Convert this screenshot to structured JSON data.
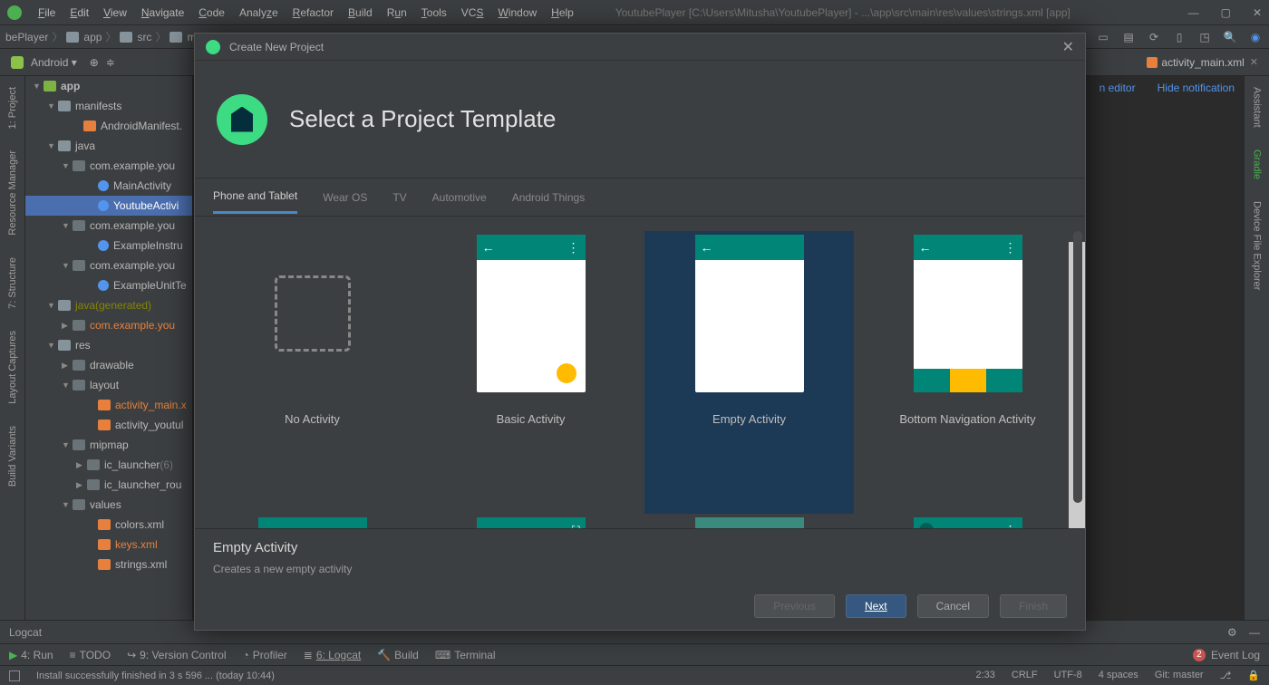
{
  "menubar": {
    "items": [
      "File",
      "Edit",
      "View",
      "Navigate",
      "Code",
      "Analyze",
      "Refactor",
      "Build",
      "Run",
      "Tools",
      "VCS",
      "Window",
      "Help"
    ],
    "title": "YoutubePlayer [C:\\Users\\Mitusha\\YoutubePlayer] - ...\\app\\src\\main\\res\\values\\strings.xml [app]"
  },
  "breadcrumbs": [
    "bePlayer",
    "app",
    "src",
    "ma"
  ],
  "toolbar": {
    "configLabel": "Android"
  },
  "openTab": {
    "name": "activity_main.xml"
  },
  "notif": {
    "editor": "n editor",
    "hide": "Hide notification"
  },
  "leftPanels": [
    "1: Project",
    "Resource Manager",
    "7: Structure",
    "Layout Captures",
    "Build Variants"
  ],
  "rightPanels": [
    "Assistant",
    "Gradle",
    "Device File Explorer"
  ],
  "tree": [
    {
      "ind": 8,
      "arrow": "▼",
      "icon": "f-mod",
      "label": "app",
      "bold": true
    },
    {
      "ind": 24,
      "arrow": "▼",
      "icon": "f-fold",
      "label": "manifests"
    },
    {
      "ind": 52,
      "arrow": "",
      "icon": "f-xml",
      "label": "AndroidManifest."
    },
    {
      "ind": 24,
      "arrow": "▼",
      "icon": "f-fold",
      "label": "java"
    },
    {
      "ind": 40,
      "arrow": "▼",
      "icon": "f-pkg",
      "label": "com.example.you"
    },
    {
      "ind": 68,
      "arrow": "",
      "icon": "f-java",
      "label": "MainActivity"
    },
    {
      "ind": 68,
      "arrow": "",
      "icon": "f-java",
      "label": "YoutubeActivi",
      "sel": true
    },
    {
      "ind": 40,
      "arrow": "▼",
      "icon": "f-pkg",
      "label": "com.example.you"
    },
    {
      "ind": 68,
      "arrow": "",
      "icon": "f-java",
      "label": "ExampleInstru"
    },
    {
      "ind": 40,
      "arrow": "▼",
      "icon": "f-pkg",
      "label": "com.example.you"
    },
    {
      "ind": 68,
      "arrow": "",
      "icon": "f-java",
      "label": "ExampleUnitTe"
    },
    {
      "ind": 24,
      "arrow": "▼",
      "icon": "f-fold",
      "label": "java",
      "gen": "(generated)"
    },
    {
      "ind": 40,
      "arrow": "▶",
      "icon": "f-pkg",
      "label": "com.example.you",
      "hl": true
    },
    {
      "ind": 24,
      "arrow": "▼",
      "icon": "f-fold",
      "label": "res"
    },
    {
      "ind": 40,
      "arrow": "▶",
      "icon": "f-folddark",
      "label": "drawable"
    },
    {
      "ind": 40,
      "arrow": "▼",
      "icon": "f-folddark",
      "label": "layout"
    },
    {
      "ind": 68,
      "arrow": "",
      "icon": "f-xml",
      "label": "activity_main.x",
      "hl": true
    },
    {
      "ind": 68,
      "arrow": "",
      "icon": "f-xml",
      "label": "activity_youtul"
    },
    {
      "ind": 40,
      "arrow": "▼",
      "icon": "f-folddark",
      "label": "mipmap"
    },
    {
      "ind": 56,
      "arrow": "▶",
      "icon": "f-folddark",
      "label": "ic_launcher",
      "suffix": "(6)"
    },
    {
      "ind": 56,
      "arrow": "▶",
      "icon": "f-folddark",
      "label": "ic_launcher_rou"
    },
    {
      "ind": 40,
      "arrow": "▼",
      "icon": "f-folddark",
      "label": "values"
    },
    {
      "ind": 68,
      "arrow": "",
      "icon": "f-xml",
      "label": "colors.xml"
    },
    {
      "ind": 68,
      "arrow": "",
      "icon": "f-xml",
      "label": "keys.xml",
      "hl": true
    },
    {
      "ind": 68,
      "arrow": "",
      "icon": "f-xml",
      "label": "strings.xml"
    }
  ],
  "logcat": {
    "title": "Logcat"
  },
  "bottomTabs": {
    "items": [
      "4: Run",
      "TODO",
      "9: Version Control",
      "Profiler",
      "6: Logcat",
      "Build",
      "Terminal"
    ],
    "eventLog": "Event Log",
    "badge": "2"
  },
  "status": {
    "msg": "Install successfully finished in 3 s 596 ... (today 10:44)",
    "pos": "2:33",
    "crlf": "CRLF",
    "enc": "UTF-8",
    "indent": "4 spaces",
    "git": "Git: master"
  },
  "dialog": {
    "title": "Create New Project",
    "heading": "Select a Project Template",
    "tabs": [
      "Phone and Tablet",
      "Wear OS",
      "TV",
      "Automotive",
      "Android Things"
    ],
    "templates": [
      "No Activity",
      "Basic Activity",
      "Empty Activity",
      "Bottom Navigation Activity"
    ],
    "selected": {
      "title": "Empty Activity",
      "desc": "Creates a new empty activity"
    },
    "buttons": {
      "previous": "Previous",
      "next": "Next",
      "cancel": "Cancel",
      "finish": "Finish"
    }
  }
}
